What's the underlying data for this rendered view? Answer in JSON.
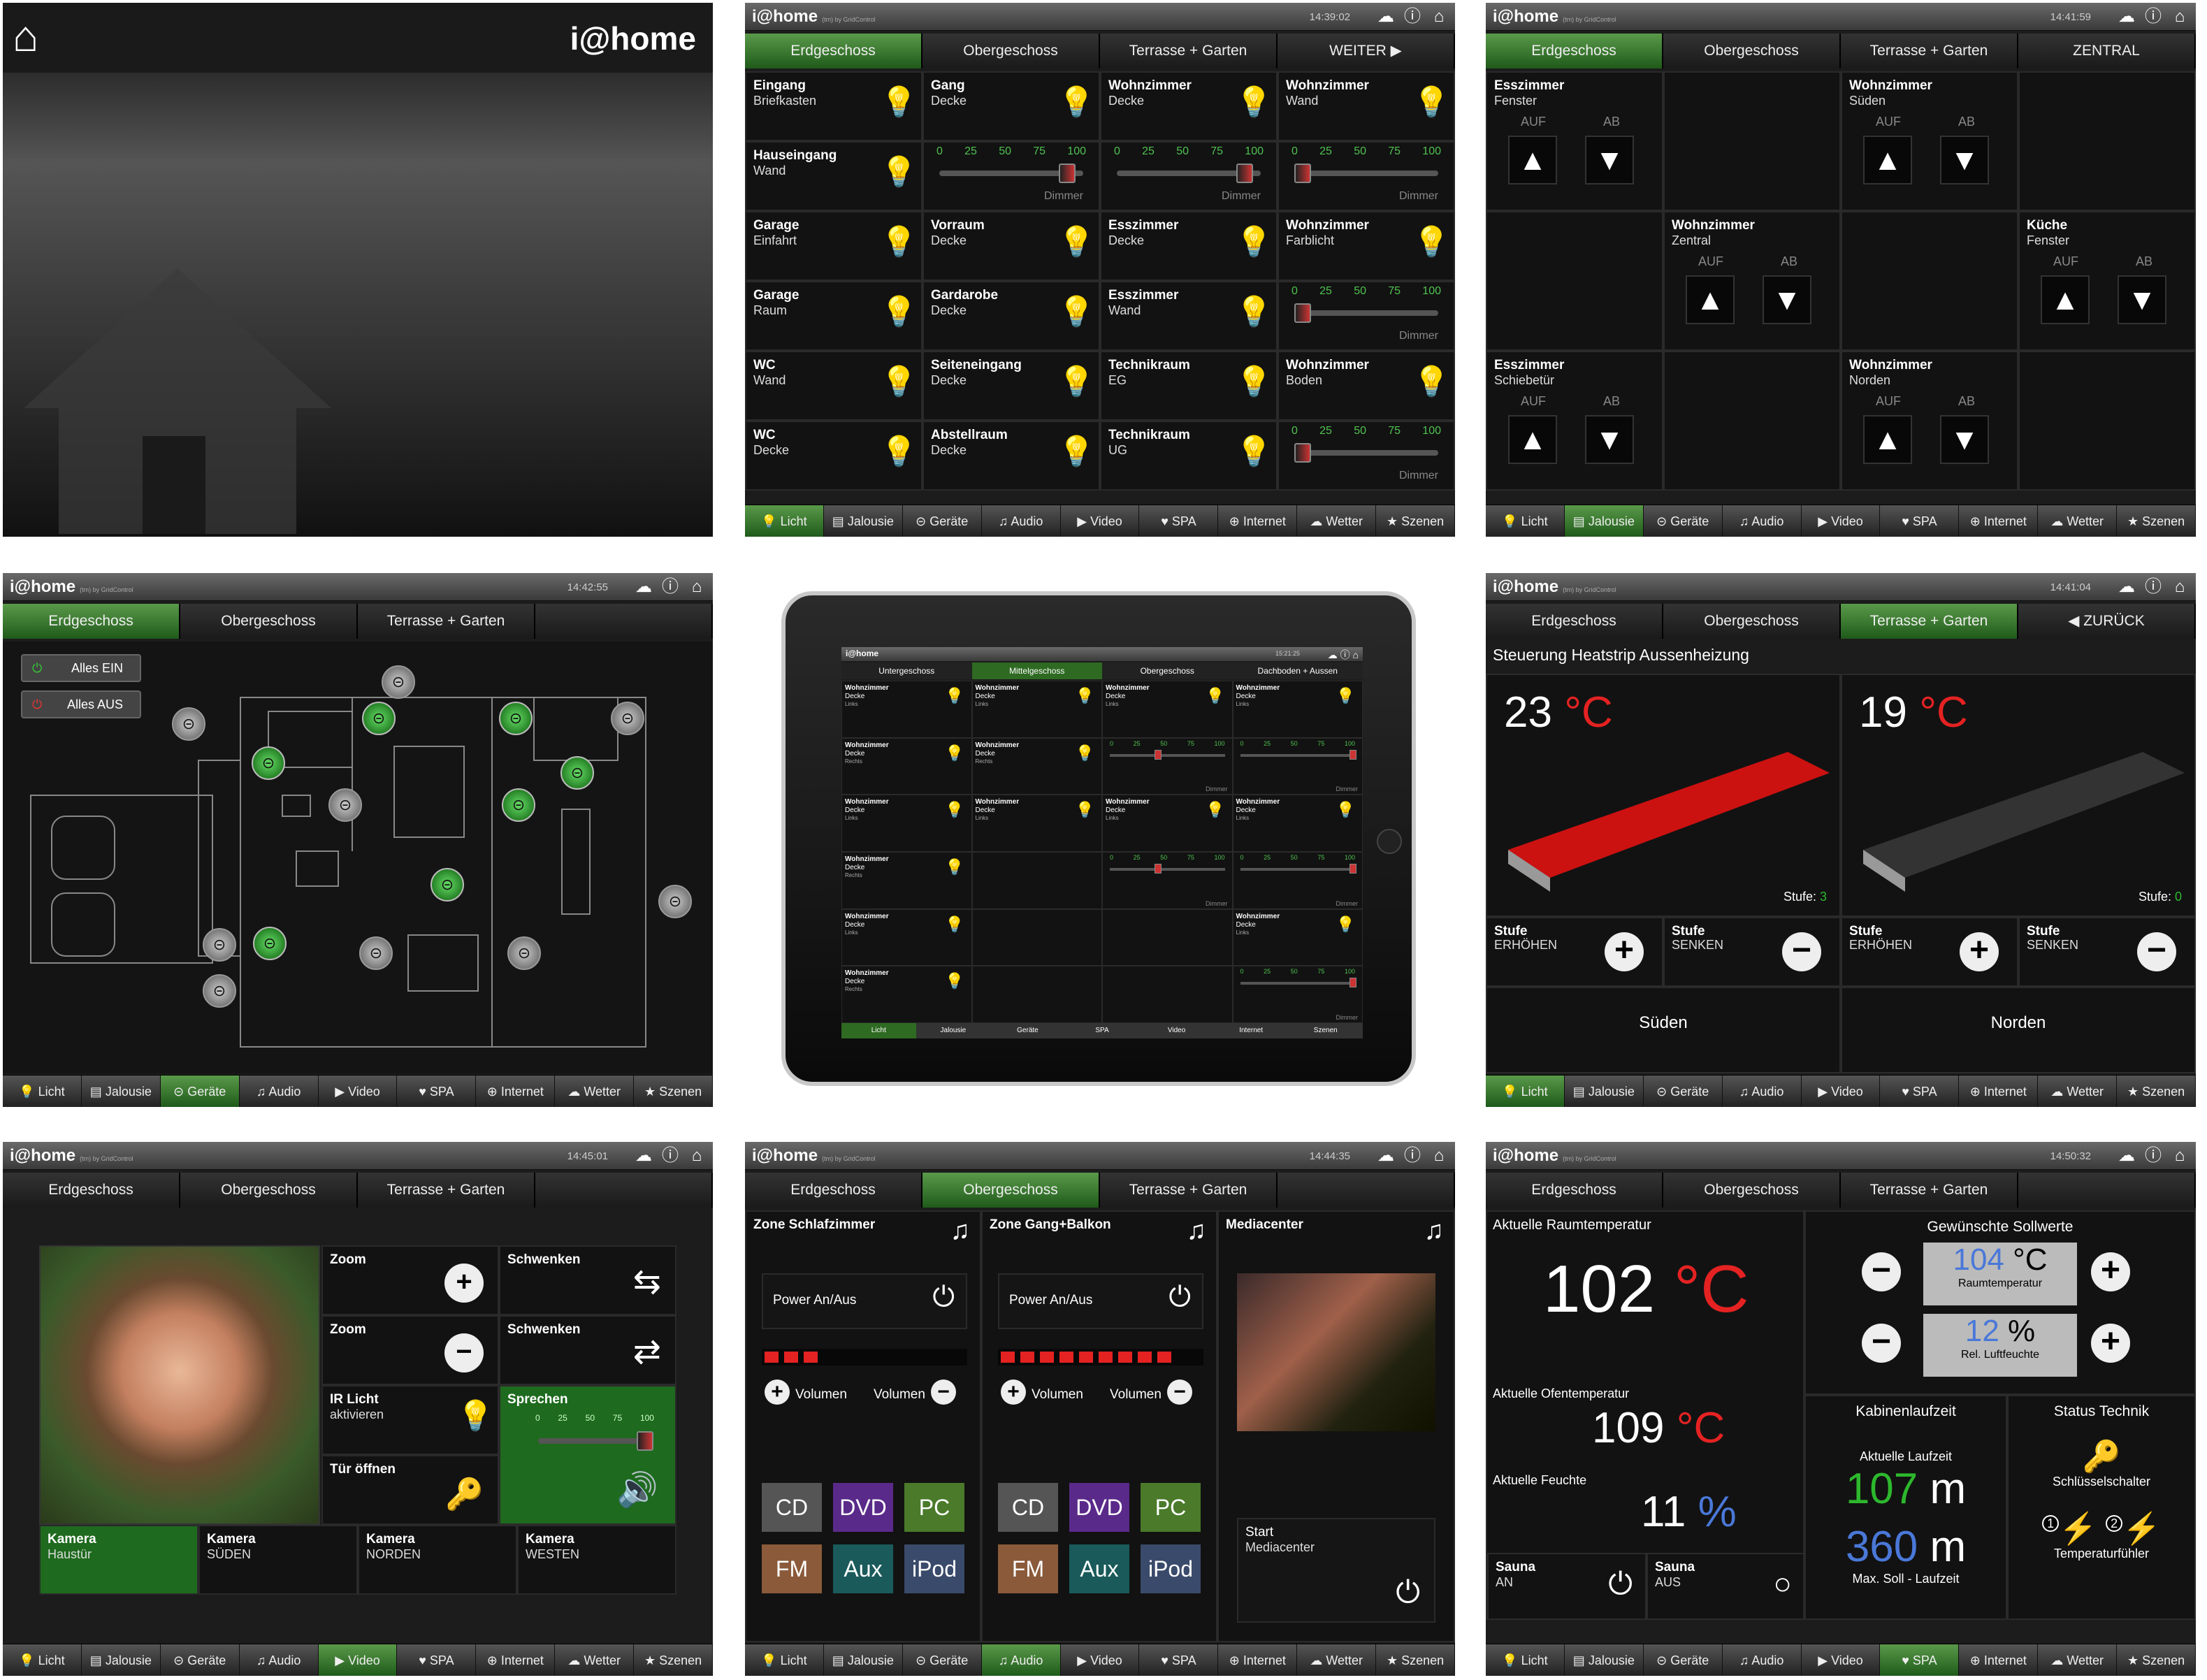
{
  "brand": "i@home",
  "brand_sub": "(tm) by GridControl",
  "bottom_nav": [
    "Licht",
    "Jalousie",
    "Geräte",
    "Audio",
    "Video",
    "SPA",
    "Internet",
    "Wetter",
    "Szenen"
  ],
  "p1": {
    "title": "i@home"
  },
  "p2": {
    "time": "14:39:02",
    "tabs": [
      "Erdgeschoss",
      "Obergeschoss",
      "Terrasse + Garten",
      "WEITER"
    ],
    "cells": [
      [
        "Eingang",
        "Briefkasten"
      ],
      [
        "Gang",
        "Decke"
      ],
      [
        "Wohnzimmer",
        "Decke"
      ],
      [
        "Wohnzimmer",
        "Wand"
      ],
      [
        "Hauseingang",
        "Wand"
      ],
      [
        "",
        "Dimmer"
      ],
      [
        "",
        "Dimmer"
      ],
      [
        "",
        "Dimmer"
      ],
      [
        "Garage",
        "Einfahrt"
      ],
      [
        "Vorraum",
        "Decke"
      ],
      [
        "Esszimmer",
        "Decke"
      ],
      [
        "Wohnzimmer",
        "Farblicht"
      ],
      [
        "Garage",
        "Raum"
      ],
      [
        "Gardarobe",
        "Decke"
      ],
      [
        "Esszimmer",
        "Wand"
      ],
      [
        "",
        "Dimmer"
      ],
      [
        "WC",
        "Wand"
      ],
      [
        "Seiteneingang",
        "Decke"
      ],
      [
        "Technikraum",
        "EG"
      ],
      [
        "Wohnzimmer",
        "Boden"
      ],
      [
        "WC",
        "Decke"
      ],
      [
        "Abstellraum",
        "Decke"
      ],
      [
        "Technikraum",
        "UG"
      ],
      [
        "",
        "Dimmer"
      ]
    ],
    "ticks": [
      "0",
      "25",
      "50",
      "75",
      "100"
    ]
  },
  "p3": {
    "time": "14:41:59",
    "tabs": [
      "Erdgeschoss",
      "Obergeschoss",
      "Terrasse + Garten",
      "ZENTRAL"
    ],
    "up": "AUF",
    "down": "AB",
    "cells": [
      [
        "Esszimmer",
        "Fenster"
      ],
      [
        "",
        ""
      ],
      [
        "Wohnzimmer",
        "Süden"
      ],
      [
        "",
        ""
      ],
      [
        "",
        ""
      ],
      [
        "Wohnzimmer",
        "Zentral"
      ],
      [
        "",
        ""
      ],
      [
        "Küche",
        "Fenster"
      ],
      [
        "Esszimmer",
        "Schiebetür"
      ],
      [
        "",
        ""
      ],
      [
        "Wohnzimmer",
        "Norden"
      ],
      [
        "",
        ""
      ]
    ]
  },
  "p4": {
    "time": "14:42:55",
    "tabs": [
      "Erdgeschoss",
      "Obergeschoss",
      "Terrasse + Garten"
    ],
    "all_on": "Alles EIN",
    "all_off": "Alles AUS"
  },
  "p5": {
    "time": "15:21:25",
    "tabs": [
      "Untergeschoss",
      "Mittelgeschoss",
      "Obergeschoss",
      "Dachboden + Aussen"
    ],
    "nav": [
      "Licht",
      "Jalousie",
      "Geräte",
      "SPA",
      "Video",
      "Internet",
      "Szenen"
    ],
    "cell_title": "Wohnzimmer",
    "cell_sub": "Decke",
    "cell_links": "Links",
    "cell_rechts": "Rechts",
    "dimmer": "Dimmer"
  },
  "p6": {
    "time": "14:41:04",
    "tabs": [
      "Erdgeschoss",
      "Obergeschoss",
      "Terrasse + Garten",
      "ZURÜCK"
    ],
    "heading": "Steuerung Heatstrip Aussenheizung",
    "left": {
      "temp": "23",
      "unit": "°C",
      "stufe_label": "Stufe:",
      "stufe": "3",
      "zone": "Süden"
    },
    "right": {
      "temp": "19",
      "unit": "°C",
      "stufe_label": "Stufe:",
      "stufe": "0",
      "zone": "Norden"
    },
    "stufe": "Stufe",
    "up": "ERHÖHEN",
    "down": "SENKEN"
  },
  "p7": {
    "time": "14:45:01",
    "tabs": [
      "Erdgeschoss",
      "Obergeschoss",
      "Terrasse + Garten"
    ],
    "zoom": "Zoom",
    "schwenken": "Schwenken",
    "ir": "IR Licht",
    "ir_sub": "aktivieren",
    "speak": "Sprechen",
    "door": "Tür öffnen",
    "cams": [
      [
        "Kamera",
        "Haustür"
      ],
      [
        "Kamera",
        "SÜDEN"
      ],
      [
        "Kamera",
        "NORDEN"
      ],
      [
        "Kamera",
        "WESTEN"
      ]
    ]
  },
  "p8": {
    "time": "14:44:35",
    "tabs": [
      "Erdgeschoss",
      "Obergeschoss",
      "Terrasse + Garten"
    ],
    "zone1": "Zone Schlafzimmer",
    "zone2": "Zone Gang+Balkon",
    "zone3": "Mediacenter",
    "power": "Power An/Aus",
    "vol": "Volumen",
    "sources": [
      "CD",
      "DVD",
      "PC",
      "FM",
      "Aux",
      "iPod"
    ],
    "start": "Start",
    "start_sub": "Mediacenter"
  },
  "p9": {
    "time": "14:50:32",
    "tabs": [
      "Erdgeschoss",
      "Obergeschoss",
      "Terrasse + Garten"
    ],
    "room_label": "Aktuelle Raumtemperatur",
    "room_temp": "102",
    "unit_c": "°C",
    "target_label": "Gewünschte Sollwerte",
    "target_temp": "104",
    "target_temp_label": "Raumtemperatur",
    "target_hum": "12",
    "unit_pct": "%",
    "target_hum_label": "Rel. Luftfeuchte",
    "oven_label": "Aktuelle Ofentemperatur",
    "oven_temp": "109",
    "hum_label": "Aktuelle Feuchte",
    "hum": "11",
    "run_title": "Kabinenlaufzeit",
    "run_label": "Aktuelle Laufzeit",
    "run": "107",
    "run_unit": "m",
    "max_run": "360",
    "max_label": "Max. Soll - Laufzeit",
    "tech_title": "Status Technik",
    "key_label": "Schlüsselschalter",
    "temp_sensor": "Temperaturfühler",
    "sauna": "Sauna",
    "an": "AN",
    "aus": "AUS",
    "s1": "1",
    "s2": "2"
  }
}
